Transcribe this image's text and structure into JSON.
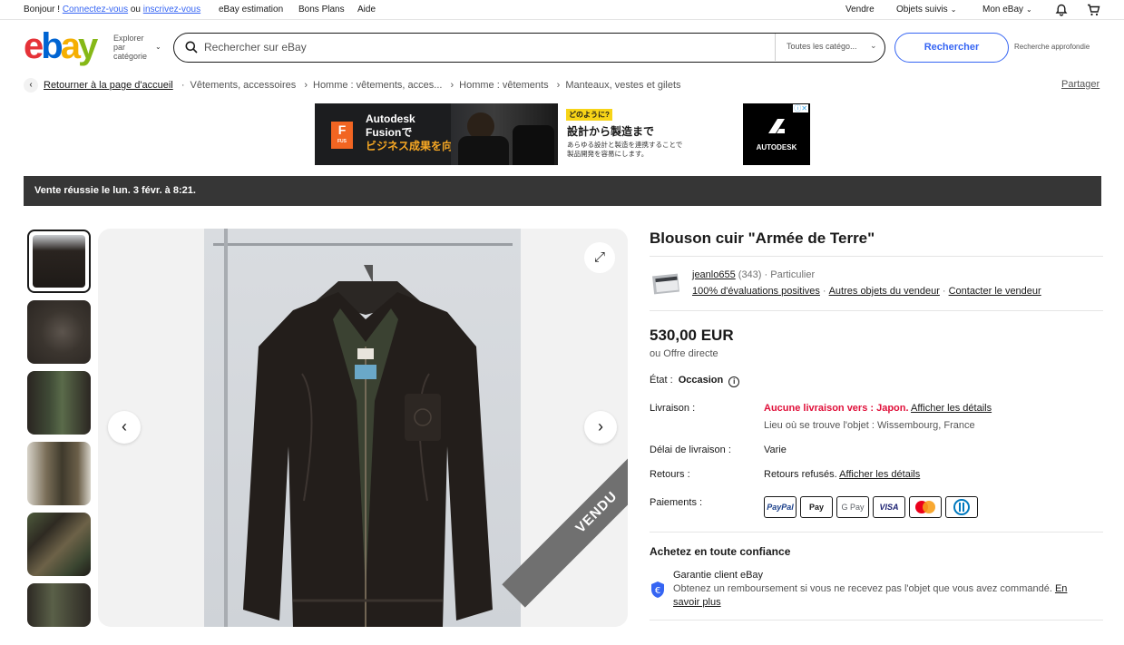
{
  "topbar": {
    "greeting": "Bonjour !",
    "signin": "Connectez-vous",
    "or": "ou",
    "register": "inscrivez-vous",
    "links": [
      "eBay estimation",
      "Bons Plans",
      "Aide"
    ],
    "sell": "Vendre",
    "watchlist": "Objets suivis",
    "my_ebay": "Mon eBay"
  },
  "header": {
    "logo": "ebay",
    "explore": "Explorer par catégorie",
    "search_placeholder": "Rechercher sur eBay",
    "category": "Toutes les catégo...",
    "search_button": "Rechercher",
    "advanced": "Recherche approfondie"
  },
  "breadcrumb": {
    "home": "Retourner à la page d'accueil",
    "items": [
      "Vêtements, accessoires",
      "Homme : vêtements, acces...",
      "Homme : vêtements",
      "Manteaux, vestes et gilets"
    ],
    "share": "Partager"
  },
  "ad": {
    "line1": "Autodesk",
    "line2": "Fusionで",
    "line3": "ビジネス成果を向上",
    "icon_label": "F",
    "icon_sub": "FUS",
    "tag": "どのように?",
    "headline": "設計から製造まで",
    "sub1": "あらゆる設計と製造を連携することで",
    "sub2": "製品開発を容易にします。",
    "brand": "AUTODESK"
  },
  "sold_banner": "Vente réussie le lun. 3 févr. à 8:21.",
  "listing": {
    "title": "Blouson cuir \"Armée de Terre\"",
    "sold_overlay": "VENDU",
    "seller_name": "jeanlo655",
    "seller_count": "(343)",
    "seller_type": "· Particulier",
    "feedback": "100% d'évaluations positives",
    "other_items": "Autres objets du vendeur",
    "contact": "Contacter le vendeur",
    "price": "530,00 EUR",
    "offer": "ou Offre directe",
    "condition_label": "État :",
    "condition_value": "Occasion",
    "shipping_label": "Livraison :",
    "shipping_value": "Aucune livraison vers : Japon.",
    "shipping_details": "Afficher les détails",
    "location": "Lieu où se trouve l'objet : Wissembourg, France",
    "delay_label": "Délai de livraison :",
    "delay_value": "Varie",
    "returns_label": "Retours :",
    "returns_value": "Retours refusés.",
    "returns_details": "Afficher les détails",
    "payments_label": "Paiements :",
    "payments": [
      "PayPal",
      "Pay",
      "G Pay",
      "VISA",
      "",
      ""
    ],
    "confidence_title": "Achetez en toute confiance",
    "guarantee_title": "Garantie client eBay",
    "guarantee_text": "Obtenez un remboursement si vous ne recevez pas l'objet que vous avez commandé.",
    "guarantee_link": "En savoir plus"
  },
  "colors": {
    "accent": "#3665f3",
    "banner": "#363636",
    "alert": "#e0103a"
  }
}
